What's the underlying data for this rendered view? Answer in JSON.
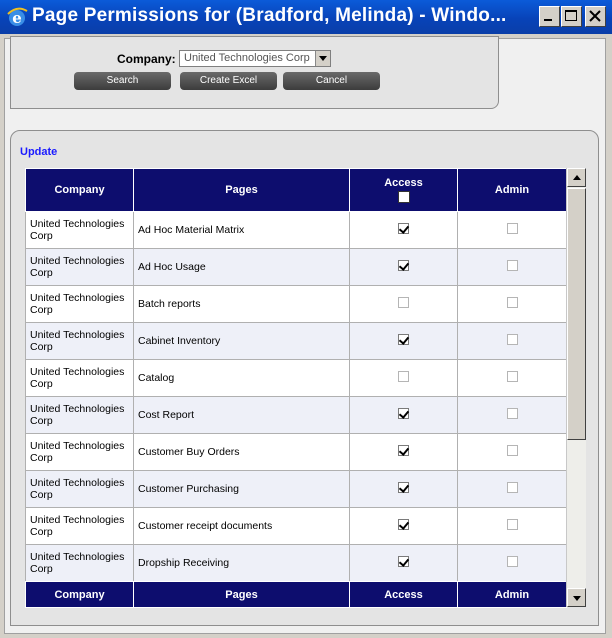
{
  "window": {
    "title": "Page Permissions for (Bradford, Melinda) - Windo..."
  },
  "filter": {
    "company_label": "Company:",
    "company_value": "United Technologies Corp",
    "search_label": "Search",
    "excel_label": "Create Excel",
    "cancel_label": "Cancel"
  },
  "update_label": "Update",
  "grid": {
    "headers": {
      "company": "Company",
      "pages": "Pages",
      "access": "Access",
      "admin": "Admin"
    },
    "rows": [
      {
        "company": "United Technologies Corp",
        "page": "Ad Hoc Material Matrix",
        "access": true,
        "admin": false
      },
      {
        "company": "United Technologies Corp",
        "page": "Ad Hoc Usage",
        "access": true,
        "admin": false
      },
      {
        "company": "United Technologies Corp",
        "page": "Batch reports",
        "access": false,
        "admin": false
      },
      {
        "company": "United Technologies Corp",
        "page": "Cabinet Inventory",
        "access": true,
        "admin": false
      },
      {
        "company": "United Technologies Corp",
        "page": "Catalog",
        "access": false,
        "admin": false
      },
      {
        "company": "United Technologies Corp",
        "page": "Cost Report",
        "access": true,
        "admin": false
      },
      {
        "company": "United Technologies Corp",
        "page": "Customer Buy Orders",
        "access": true,
        "admin": false
      },
      {
        "company": "United Technologies Corp",
        "page": "Customer Purchasing",
        "access": true,
        "admin": false
      },
      {
        "company": "United Technologies Corp",
        "page": "Customer receipt documents",
        "access": true,
        "admin": false
      },
      {
        "company": "United Technologies Corp",
        "page": "Dropship Receiving",
        "access": true,
        "admin": false
      }
    ]
  },
  "colors": {
    "header_bg": "#0d0d6e",
    "link": "#1a1aff",
    "titlebar": "#0843b8"
  },
  "icons": [
    "ie-icon",
    "minimize-icon",
    "maximize-icon",
    "close-icon",
    "dropdown-arrow-icon",
    "scroll-up-icon",
    "scroll-down-icon"
  ]
}
